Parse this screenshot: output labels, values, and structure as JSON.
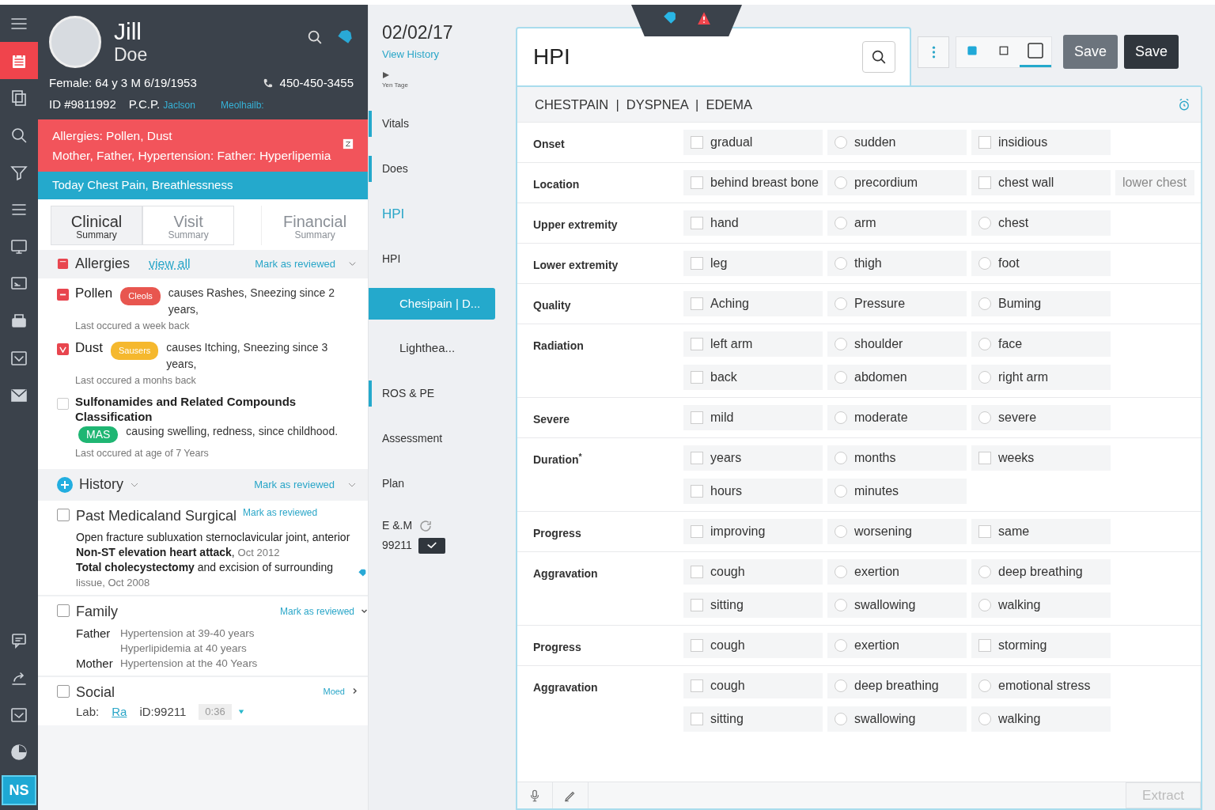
{
  "rail": {
    "top": [
      {
        "kind": "menu",
        "selected": false
      },
      {
        "kind": "calendar",
        "selected": true
      },
      {
        "kind": "copy",
        "selected": false
      },
      {
        "kind": "search",
        "selected": false
      },
      {
        "kind": "filter",
        "selected": false
      },
      {
        "kind": "list",
        "selected": false
      },
      {
        "kind": "monitor",
        "selected": false
      },
      {
        "kind": "screen",
        "selected": false
      },
      {
        "kind": "printer",
        "selected": false
      },
      {
        "kind": "inbox",
        "selected": false
      },
      {
        "kind": "mail",
        "selected": false
      }
    ],
    "bottom": [
      {
        "kind": "chat",
        "selected": false
      },
      {
        "kind": "share",
        "selected": false
      },
      {
        "kind": "check",
        "selected": false
      },
      {
        "kind": "pie",
        "selected": false
      }
    ],
    "logo": "NS"
  },
  "patient": {
    "first_name": "Jill",
    "last_name": "Doe",
    "demographics": "Female: 64 y 3 M 6/19/1953",
    "phone": "450-450-3455",
    "id": "ID #9811992",
    "pcp_label": "P.C.P.",
    "pcp": "Jaclson",
    "extra": "Meolhailb:",
    "alerts": [
      "Allergies: Pollen, Dust",
      "Mother, Father, Hypertension: Father: Hyperlipemia"
    ],
    "today": "Today Chest Pain, Breathlessness"
  },
  "summary_tabs": [
    {
      "title": "Clinical",
      "subtitle": "Summary",
      "selected": true
    },
    {
      "title": "Visit",
      "subtitle": "Summary",
      "selected": false
    },
    {
      "title": "Financial",
      "subtitle": "Summary",
      "selected": false
    }
  ],
  "allergies": {
    "title": "Allergies",
    "link": "view all",
    "action": "Mark as reviewed",
    "items": [
      {
        "kind": "minus",
        "name": "Pollen",
        "tag": "Cleols",
        "color": "#e8564f",
        "text": "causes Rashes, Sneezing since 2 years,",
        "note": "Last occured a week back"
      },
      {
        "kind": "check",
        "name": "Dust",
        "tag": "Sausers",
        "color": "#f5b82e",
        "text": "causes Itching, Sneezing since 3 years,",
        "note": "Last occured a monhs back"
      },
      {
        "kind": "none",
        "name": "Sulfonamides and Related Compounds Classification",
        "tag": "MAS",
        "color": "#1fb673",
        "text": "causing swelling, redness, since childhood.",
        "note": "Last occured at age of 7 Years"
      }
    ]
  },
  "history": {
    "title": "History",
    "action": "Mark as reviewed",
    "past": {
      "title": "Past Medicaland Surgical",
      "action": "Mark as reviewed",
      "checked": false,
      "entries": [
        {
          "text": "Open fracture subluxation sternoclavicular joint, anterior"
        },
        {
          "text": "**Non-ST elevation heart attack**,",
          "date": "Oct 2012"
        },
        {
          "text": "**Total cholecystectomy** and excision of surrounding",
          "date": "lissue, Oct 2008"
        }
      ]
    },
    "family": {
      "title": "Family",
      "action": "Mark as reviewed",
      "checked": false,
      "members": [
        {
          "relation": "Father",
          "conditions": [
            "Hypertension at 39-40 years",
            "Hyperlipidemia at 40 years"
          ]
        },
        {
          "relation": "Mother",
          "conditions": [
            "Hypertension at the 40 Years"
          ]
        }
      ]
    },
    "social": {
      "title": "Social",
      "action": "Moed",
      "checked": false,
      "lab_label": "Lab:",
      "lab": "Ra",
      "id": "iD:99211",
      "time": "0:36"
    }
  },
  "visit_nav": {
    "date": "02/02/17",
    "history_link": "View History",
    "triage": "Yen Tage",
    "items": [
      {
        "kind": "section",
        "label": "Vitals",
        "selected": false,
        "marked": true
      },
      {
        "kind": "section",
        "label": "Does",
        "selected": false,
        "marked": true
      },
      {
        "kind": "heading",
        "label": "HPI",
        "selected": true,
        "marked": false
      },
      {
        "kind": "section",
        "label": "HPI",
        "selected": false,
        "marked": false
      },
      {
        "kind": "sub",
        "label": "Chesipain | D...",
        "selected": true,
        "marked": false
      },
      {
        "kind": "sub",
        "label": "Lighthea...",
        "selected": false,
        "marked": false
      },
      {
        "kind": "section",
        "label": "ROS & PE",
        "selected": false,
        "marked": true
      },
      {
        "kind": "section",
        "label": "Assessment",
        "selected": false,
        "marked": false
      },
      {
        "kind": "section",
        "label": "Plan",
        "selected": false,
        "marked": false
      }
    ],
    "em_label": "E &.M",
    "em_code": "99211"
  },
  "hpi": {
    "title": "HPI",
    "view_sizes": [
      {
        "kind": "filled",
        "selected": false
      },
      {
        "kind": "small",
        "selected": false
      },
      {
        "kind": "large",
        "selected": true
      }
    ],
    "buttons": [
      {
        "label": "Save",
        "kind": "secondary"
      },
      {
        "label": "Save",
        "kind": "primary"
      }
    ],
    "complaints": "CHESTPAIN  |  DYSPNEA  |  EDEMA",
    "rows": [
      {
        "label": "Onset",
        "lines": [
          [
            {
              "kind": "checkbox",
              "label": "gradual",
              "checked": false
            },
            {
              "kind": "radio",
              "label": "sudden",
              "checked": false
            },
            {
              "kind": "checkbox",
              "label": "insidious",
              "checked": false
            }
          ]
        ]
      },
      {
        "label": "Location",
        "lines": [
          [
            {
              "kind": "checkbox",
              "label": "behind breast bone",
              "checked": false
            },
            {
              "kind": "radio",
              "label": "precordium",
              "checked": false
            },
            {
              "kind": "checkbox",
              "label": "chest wall",
              "checked": false
            },
            {
              "kind": "text",
              "label": "lower chest"
            }
          ]
        ]
      },
      {
        "label": "Upper extremity",
        "lines": [
          [
            {
              "kind": "checkbox",
              "label": "hand",
              "checked": false
            },
            {
              "kind": "radio",
              "label": "arm",
              "checked": false
            },
            {
              "kind": "radio",
              "label": "chest",
              "checked": false
            }
          ]
        ]
      },
      {
        "label": "Lower extremity",
        "lines": [
          [
            {
              "kind": "checkbox",
              "label": "leg",
              "checked": false
            },
            {
              "kind": "radio",
              "label": "thigh",
              "checked": false
            },
            {
              "kind": "radio",
              "label": "foot",
              "checked": false
            }
          ]
        ]
      },
      {
        "label": "Quality",
        "lines": [
          [
            {
              "kind": "checkbox",
              "label": "Aching",
              "checked": false
            },
            {
              "kind": "radio",
              "label": "Pressure",
              "checked": false
            },
            {
              "kind": "radio",
              "label": "Buming",
              "checked": false
            }
          ]
        ]
      },
      {
        "label": "Radiation",
        "lines": [
          [
            {
              "kind": "checkbox",
              "label": "left arm",
              "checked": false
            },
            {
              "kind": "radio",
              "label": "shoulder",
              "checked": false
            },
            {
              "kind": "radio",
              "label": "face",
              "checked": false
            }
          ],
          [
            {
              "kind": "checkbox",
              "label": "back",
              "checked": false
            },
            {
              "kind": "radio",
              "label": "abdomen",
              "checked": false
            },
            {
              "kind": "radio",
              "label": "right arm",
              "checked": false
            }
          ]
        ]
      },
      {
        "label": "Severe",
        "lines": [
          [
            {
              "kind": "checkbox",
              "label": "mild",
              "checked": false
            },
            {
              "kind": "radio",
              "label": "moderate",
              "checked": false
            },
            {
              "kind": "radio",
              "label": "severe",
              "checked": false
            }
          ]
        ]
      },
      {
        "label": "Duration$^{*}$",
        "lines": [
          [
            {
              "kind": "checkbox",
              "label": "years",
              "checked": false
            },
            {
              "kind": "radio",
              "label": "months",
              "checked": false
            },
            {
              "kind": "checkbox",
              "label": "weeks",
              "checked": false
            }
          ],
          [
            {
              "kind": "checkbox",
              "label": "hours",
              "checked": false
            },
            {
              "kind": "radio",
              "label": "minutes",
              "checked": false
            }
          ]
        ]
      },
      {
        "label": "Progress",
        "lines": [
          [
            {
              "kind": "checkbox",
              "label": "improving",
              "checked": false
            },
            {
              "kind": "radio",
              "label": "worsening",
              "checked": false
            },
            {
              "kind": "checkbox",
              "label": "same",
              "checked": false
            }
          ]
        ]
      },
      {
        "label": "Aggravation",
        "lines": [
          [
            {
              "kind": "checkbox",
              "label": "cough",
              "checked": false
            },
            {
              "kind": "radio",
              "label": "exertion",
              "checked": false
            },
            {
              "kind": "radio",
              "label": "deep breathing",
              "checked": false
            }
          ],
          [
            {
              "kind": "checkbox",
              "label": "sitting",
              "checked": false
            },
            {
              "kind": "radio",
              "label": "swallowing",
              "checked": false
            },
            {
              "kind": "radio",
              "label": "walking",
              "checked": false
            }
          ]
        ]
      },
      {
        "label": "Progress",
        "lines": [
          [
            {
              "kind": "checkbox",
              "label": "cough",
              "checked": false
            },
            {
              "kind": "radio",
              "label": "exertion",
              "checked": false
            },
            {
              "kind": "checkbox",
              "label": "storming",
              "checked": false
            }
          ]
        ]
      },
      {
        "label": "Aggravation",
        "lines": [
          [
            {
              "kind": "checkbox",
              "label": "cough",
              "checked": false
            },
            {
              "kind": "radio",
              "label": "deep breathing",
              "checked": false
            },
            {
              "kind": "radio",
              "label": "emotional stress",
              "checked": false
            }
          ],
          [
            {
              "kind": "checkbox",
              "label": "sitting",
              "checked": false
            },
            {
              "kind": "radio",
              "label": "swallowing",
              "checked": false
            },
            {
              "kind": "radio",
              "label": "walking",
              "checked": false
            }
          ]
        ]
      }
    ],
    "extract": {
      "label": "Extract",
      "disabled": true
    }
  }
}
